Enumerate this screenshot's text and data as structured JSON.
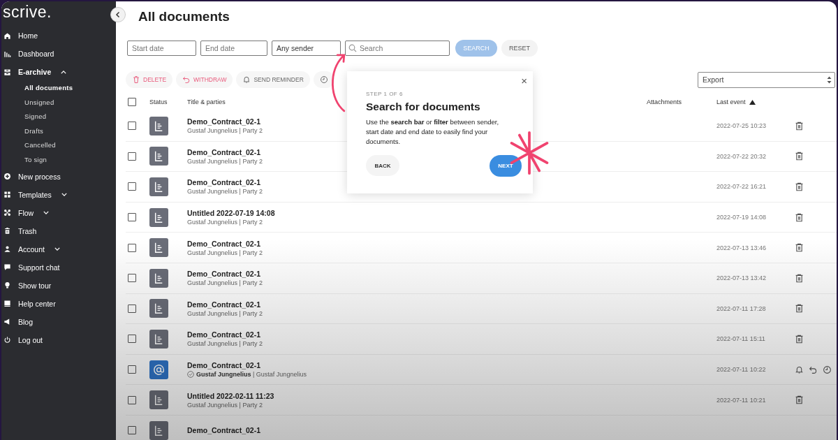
{
  "brand": "scrive.",
  "sidebar": {
    "items": [
      {
        "label": "Home",
        "selected": false,
        "expandable": false
      },
      {
        "label": "Dashboard",
        "selected": false,
        "expandable": false
      },
      {
        "label": "E-archive",
        "selected": true,
        "expandable": true,
        "expanded": true,
        "children": [
          {
            "label": "All documents",
            "selected": true
          },
          {
            "label": "Unsigned",
            "selected": false
          },
          {
            "label": "Signed",
            "selected": false
          },
          {
            "label": "Drafts",
            "selected": false
          },
          {
            "label": "Cancelled",
            "selected": false
          },
          {
            "label": "To sign",
            "selected": false
          }
        ]
      },
      {
        "label": "New process",
        "selected": false,
        "expandable": false
      },
      {
        "label": "Templates",
        "selected": false,
        "expandable": true,
        "expanded": false
      },
      {
        "label": "Flow",
        "selected": false,
        "expandable": true,
        "expanded": false
      },
      {
        "label": "Trash",
        "selected": false,
        "expandable": false
      },
      {
        "label": "Account",
        "selected": false,
        "expandable": true,
        "expanded": false
      },
      {
        "label": "Support chat",
        "selected": false,
        "expandable": false
      },
      {
        "label": "Show tour",
        "selected": false,
        "expandable": false
      },
      {
        "label": "Help center",
        "selected": false,
        "expandable": false
      },
      {
        "label": "Blog",
        "selected": false,
        "expandable": false
      },
      {
        "label": "Log out",
        "selected": false,
        "expandable": false
      }
    ]
  },
  "page_title": "All documents",
  "filters": {
    "start_date": {
      "placeholder": "Start date"
    },
    "end_date": {
      "placeholder": "End date"
    },
    "sender": "Any sender",
    "search": {
      "placeholder": "Search"
    },
    "search_button": "SEARCH",
    "reset_button": "RESET"
  },
  "actions": [
    {
      "kind": "delete",
      "label": "DELETE"
    },
    {
      "kind": "withdraw",
      "label": "WITHDRAW"
    },
    {
      "kind": "remind",
      "label": "SEND REMINDER"
    },
    {
      "kind": "extend"
    }
  ],
  "export": "Export",
  "table": {
    "all_checked": false,
    "columns": [
      {
        "label": "Status",
        "sorted": false
      },
      {
        "label": "Title & parties",
        "sorted": false
      },
      {
        "label": "Attachments",
        "sorted": false
      },
      {
        "label": "Last event",
        "sorted": true
      }
    ],
    "rows": [
      {
        "kind": "document",
        "checked": false,
        "title": "Demo_Contract_02-1",
        "parties": "Gustaf Jungnelius | Party 2",
        "signed": false,
        "last_event": "2022-07-25 10:23"
      },
      {
        "kind": "document",
        "checked": false,
        "title": "Demo_Contract_02-1",
        "parties": "Gustaf Jungnelius | Party 2",
        "signed": false,
        "last_event": "2022-07-22 20:32"
      },
      {
        "kind": "document",
        "checked": false,
        "title": "Demo_Contract_02-1",
        "parties": "Gustaf Jungnelius | Party 2",
        "signed": false,
        "last_event": "2022-07-22 16:21"
      },
      {
        "kind": "document",
        "checked": false,
        "title": "Untitled 2022-07-19 14:08",
        "parties": "Gustaf Jungnelius | Party 2",
        "signed": false,
        "last_event": "2022-07-19 14:08"
      },
      {
        "kind": "document",
        "checked": false,
        "title": "Demo_Contract_02-1",
        "parties": "Gustaf Jungnelius | Party 2",
        "signed": false,
        "last_event": "2022-07-13 13:46"
      },
      {
        "kind": "document",
        "checked": false,
        "title": "Demo_Contract_02-1",
        "parties": "Gustaf Jungnelius | Party 2",
        "signed": false,
        "last_event": "2022-07-13 13:42"
      },
      {
        "kind": "document",
        "checked": false,
        "title": "Demo_Contract_02-1",
        "parties": "Gustaf Jungnelius | Party 2",
        "signed": false,
        "last_event": "2022-07-11 17:28"
      },
      {
        "kind": "document",
        "checked": false,
        "title": "Demo_Contract_02-1",
        "parties": "Gustaf Jungnelius | Party 2",
        "signed": false,
        "last_event": "2022-07-11 15:11"
      },
      {
        "kind": "email",
        "checked": false,
        "title": "Demo_Contract_02-1",
        "parties": "**Gustaf Jungnelius** | Gustaf Jungnelius",
        "signed": true,
        "last_event": "2022-07-11 10:22"
      },
      {
        "kind": "document",
        "checked": false,
        "title": "Untitled 2022-02-11 11:23",
        "parties": "Gustaf Jungnelius | Party 2",
        "signed": false,
        "last_event": "2022-07-11 10:21"
      },
      {
        "kind": "document",
        "checked": false,
        "title": "Demo_Contract_02-1"
      }
    ]
  },
  "tour": {
    "step": "STEP 1 OF 6",
    "title": "Search for documents",
    "body": "Use the **search bar** or **filter** between sender, start date and end date to easily find your documents.",
    "close": "×",
    "back": "BACK",
    "next": "NEXT"
  }
}
